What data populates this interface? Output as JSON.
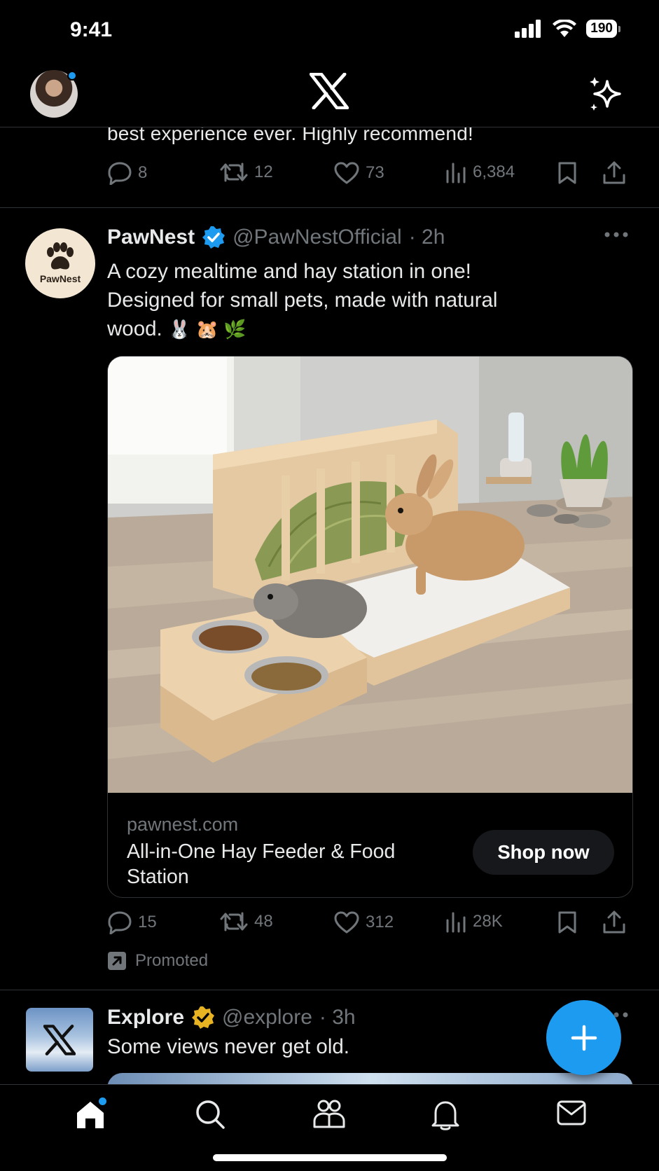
{
  "status_bar": {
    "time": "9:41",
    "battery": "190"
  },
  "previous_tweet": {
    "text_tail": "best experience ever. Highly recommend!",
    "replies": "8",
    "reposts": "12",
    "likes": "73",
    "views": "6,384"
  },
  "promoted_tweet": {
    "avatar_label": "PawNest",
    "name": "PawNest",
    "handle": "@PawNestOfficial",
    "time": "· 2h",
    "text_line1": "A cozy mealtime and hay station in one!",
    "text_line2": "Designed for small pets, made with natural",
    "text_line3": "wood.",
    "emojis": "🐰 🐹 🌿",
    "card": {
      "domain": "pawnest.com",
      "title": "All-in-One Hay Feeder & Food Station",
      "cta": "Shop now"
    },
    "replies": "15",
    "reposts": "48",
    "likes": "312",
    "views": "28K",
    "promoted_label": "Promoted"
  },
  "explore_tweet": {
    "name": "Explore",
    "handle": "@explore",
    "time": "· 3h",
    "text": "Some views never get old."
  },
  "colors": {
    "accent": "#1d9bf0",
    "background": "#000000",
    "muted": "#71767b",
    "divider": "#2f3336",
    "gold_badge": "#e8b323"
  },
  "icons": [
    "x-logo-icon",
    "grok-sparkle-icon",
    "reply-icon",
    "repost-icon",
    "like-icon",
    "views-icon",
    "bookmark-icon",
    "share-icon",
    "more-icon",
    "promoted-icon",
    "verified-badge-icon",
    "compose-icon",
    "home-icon",
    "search-icon",
    "communities-icon",
    "notifications-icon",
    "messages-icon"
  ]
}
